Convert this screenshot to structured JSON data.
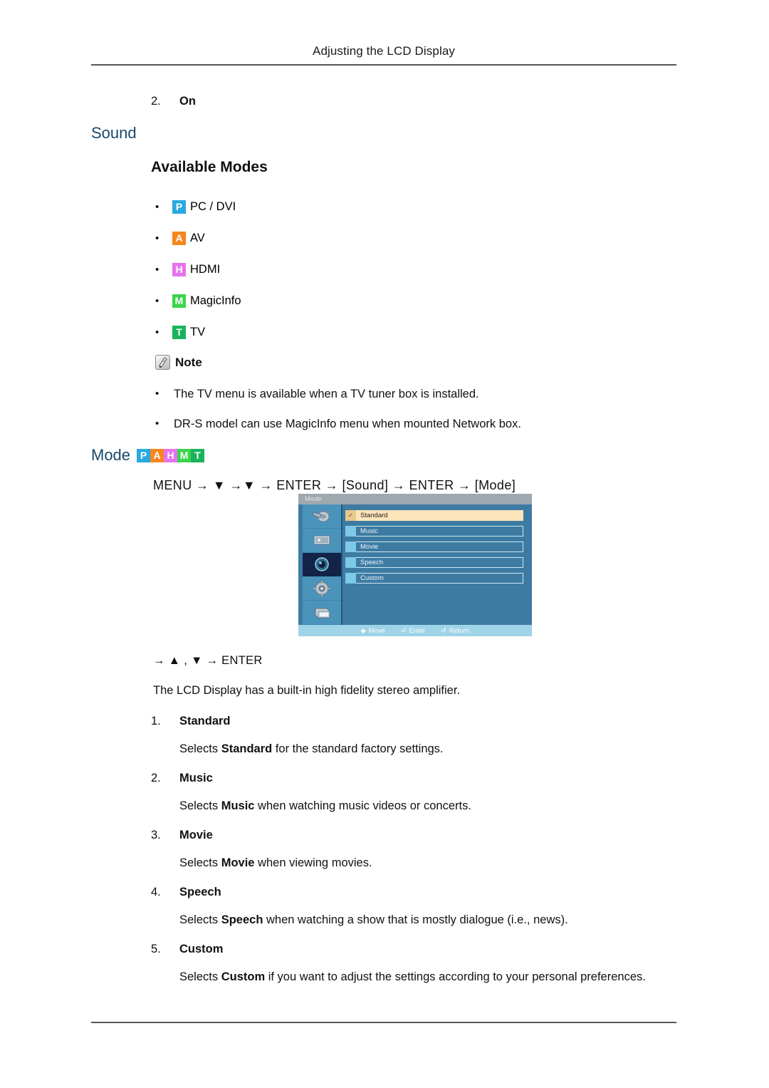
{
  "header": {
    "title": "Adjusting the LCD Display"
  },
  "top_item": {
    "number": "2.",
    "label": "On"
  },
  "sound_section": {
    "heading": "Sound",
    "available_modes_heading": "Available Modes",
    "modes": [
      {
        "chip": "P",
        "label": "PC / DVI",
        "color": "#29a9e1",
        "icon": "mode-chip-pc"
      },
      {
        "chip": "A",
        "label": "AV",
        "color": "#f6861f",
        "icon": "mode-chip-av"
      },
      {
        "chip": "H",
        "label": "HDMI",
        "color": "#e772ee",
        "icon": "mode-chip-hdmi"
      },
      {
        "chip": "M",
        "label": "MagicInfo",
        "color": "#3ad44c",
        "icon": "mode-chip-magicinfo"
      },
      {
        "chip": "T",
        "label": "TV",
        "color": "#19b35b",
        "icon": "mode-chip-tv"
      }
    ]
  },
  "note": {
    "label": "Note",
    "icon": "note-pencil-icon",
    "bullets": [
      "The TV menu is available when a TV tuner box is installed.",
      "DR-S model can use MagicInfo menu when mounted Network box."
    ]
  },
  "mode_section": {
    "heading": "Mode",
    "chips": [
      {
        "chip": "P",
        "color": "#29a9e1"
      },
      {
        "chip": "A",
        "color": "#f6861f"
      },
      {
        "chip": "H",
        "color": "#e772ee"
      },
      {
        "chip": "M",
        "color": "#3ad44c"
      },
      {
        "chip": "T",
        "color": "#19b35b"
      }
    ],
    "nav_path": "MENU → ▼ →▼ → ENTER → [Sound] → ENTER → [Mode]",
    "nav_path_2": "→ ▲ , ▼ → ENTER",
    "lead_text": "The LCD Display has a built-in high fidelity stereo amplifier."
  },
  "osd": {
    "title": "Mode",
    "sidebar_icons": [
      "picture-brush-icon",
      "screen-display-icon",
      "sound-speaker-icon",
      "setup-gear-icon",
      "multi-control-icon"
    ],
    "active_sidebar_index": 2,
    "items": [
      {
        "label": "Standard",
        "selected": true,
        "check": "✓"
      },
      {
        "label": "Music",
        "selected": false,
        "check": ""
      },
      {
        "label": "Movie",
        "selected": false,
        "check": ""
      },
      {
        "label": "Speech",
        "selected": false,
        "check": ""
      },
      {
        "label": "Custom",
        "selected": false,
        "check": ""
      }
    ],
    "footer": [
      {
        "glyph": "◆",
        "label": "Move",
        "icon": "dpad-move-icon"
      },
      {
        "glyph": "⏎",
        "label": "Enter",
        "icon": "enter-key-icon"
      },
      {
        "glyph": "↺",
        "label": "Return",
        "icon": "return-arrow-icon"
      }
    ]
  },
  "explanations": [
    {
      "number": "1.",
      "title": "Standard",
      "body_pre": "Selects ",
      "body_bold": "Standard",
      "body_post": " for the standard factory settings."
    },
    {
      "number": "2.",
      "title": "Music",
      "body_pre": "Selects ",
      "body_bold": "Music",
      "body_post": " when watching music videos or concerts."
    },
    {
      "number": "3.",
      "title": "Movie",
      "body_pre": "Selects ",
      "body_bold": "Movie",
      "body_post": " when viewing movies."
    },
    {
      "number": "4.",
      "title": "Speech",
      "body_pre": "Selects ",
      "body_bold": "Speech",
      "body_post": " when watching a show that is mostly dialogue (i.e., news)."
    },
    {
      "number": "5.",
      "title": "Custom",
      "body_pre": "Selects ",
      "body_bold": "Custom",
      "body_post": " if you want to adjust the settings according to your personal preferences."
    }
  ]
}
